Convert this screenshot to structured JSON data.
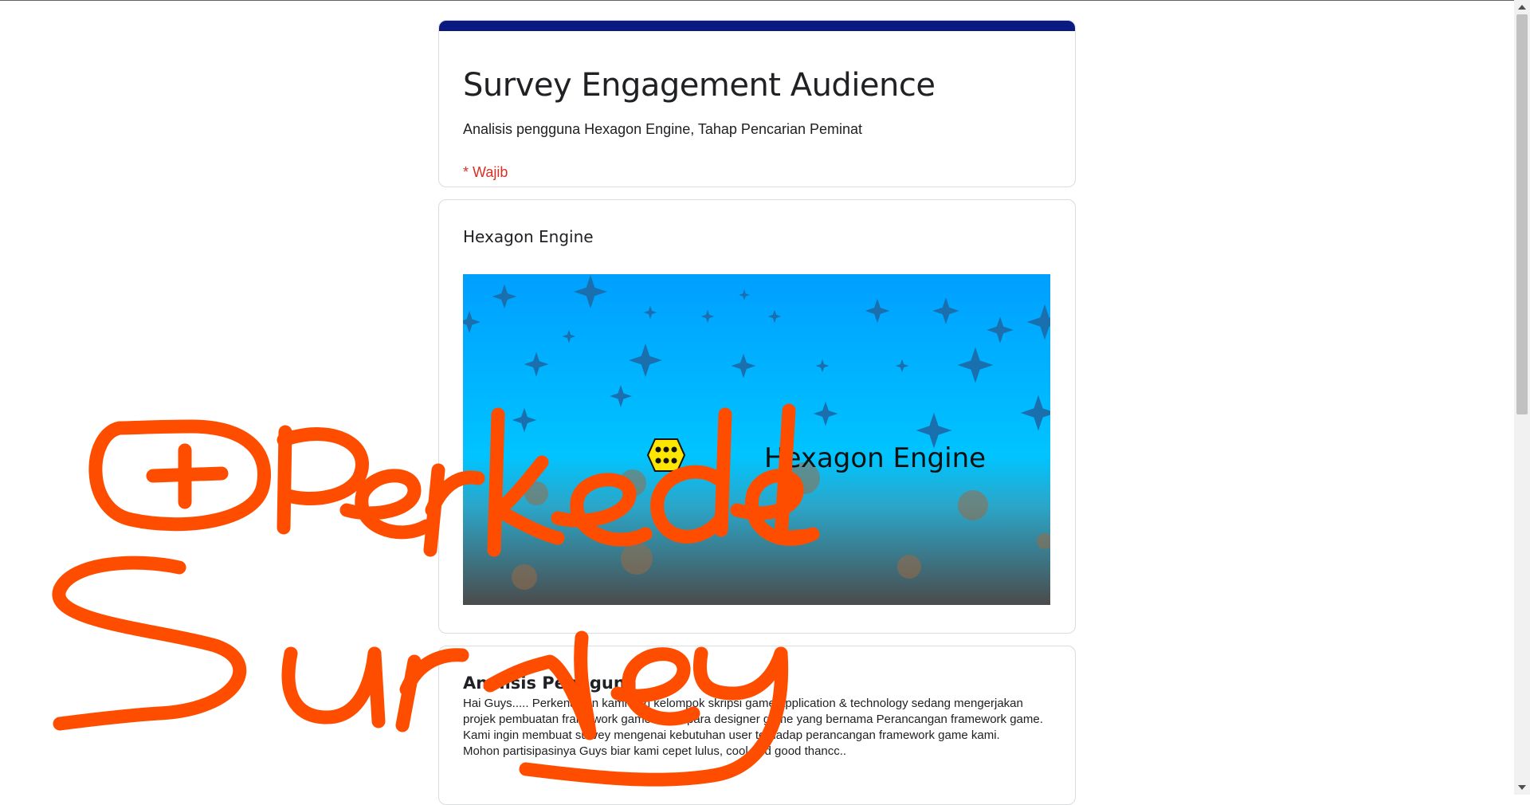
{
  "colors": {
    "accent": "#0b1a80",
    "required": "#d93025",
    "doodle": "#ff4d00",
    "banner_top": "#009fff",
    "banner_bottom": "#4b4b4b"
  },
  "form": {
    "title": "Survey Engagement Audience",
    "description": "Analisis pengguna Hexagon Engine, Tahap Pencarian Peminat",
    "required_note": "* Wajib"
  },
  "image_section": {
    "title": "Hexagon Engine",
    "banner_text": "Hexagon Engine",
    "banner_logo_icon": "hexagon-logo-icon"
  },
  "text_section": {
    "heading": "Analisis Pengguna",
    "paragraphs": [
      "Hai Guys..... Perkenalkan kami dari kelompok skripsi game application & technology sedang mengerjakan projek pembuatan framework game untuk para designer game yang bernama Perancangan framework game.",
      "Kami ingin membuat survey mengenai kebutuhan user terhadap perancangan framework game kami.",
      "Mohon partisipasinya Guys biar kami cepet lulus, cool and good thancc.."
    ]
  },
  "overlay": {
    "handwriting_line1": "+Perkedel",
    "handwriting_line2": "Survey"
  }
}
